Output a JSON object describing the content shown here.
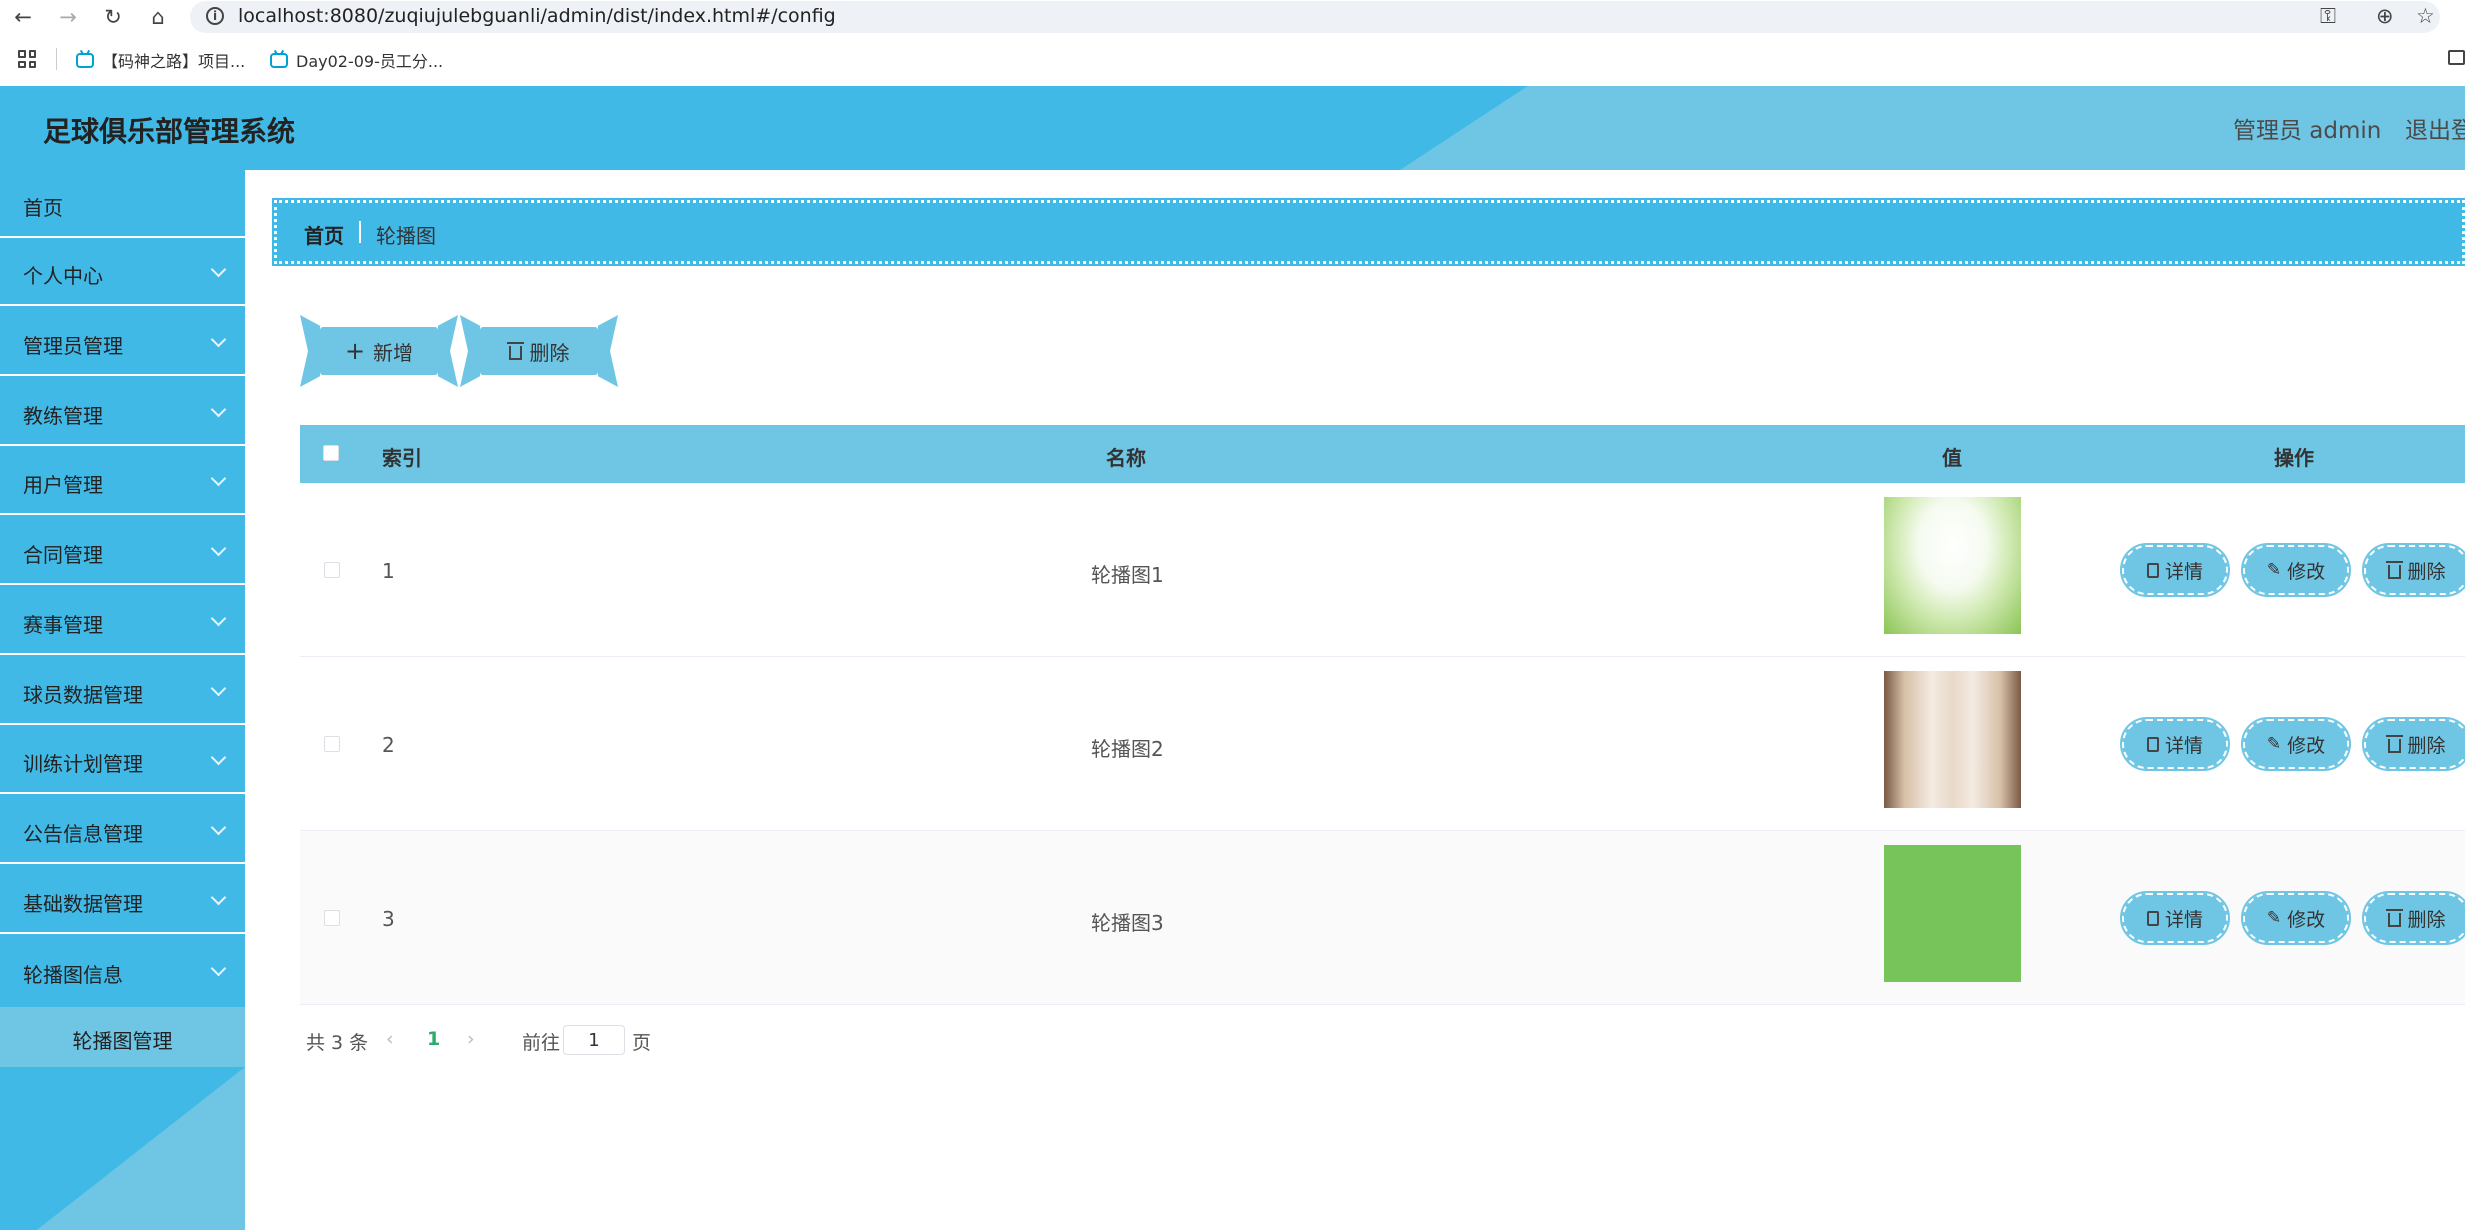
{
  "browser": {
    "url": "localhost:8080/zuqiujulebguanli/admin/dist/index.html#/config",
    "bookmarks": [
      {
        "label": "【码神之路】项目..."
      },
      {
        "label": "Day02-09-员工分..."
      }
    ]
  },
  "header": {
    "title": "足球俱乐部管理系统",
    "user": "管理员 admin",
    "logout": "退出登录"
  },
  "sidebar": {
    "items": [
      {
        "label": "首页",
        "expandable": false
      },
      {
        "label": "个人中心",
        "expandable": true
      },
      {
        "label": "管理员管理",
        "expandable": true
      },
      {
        "label": "教练管理",
        "expandable": true
      },
      {
        "label": "用户管理",
        "expandable": true
      },
      {
        "label": "合同管理",
        "expandable": true
      },
      {
        "label": "赛事管理",
        "expandable": true
      },
      {
        "label": "球员数据管理",
        "expandable": true
      },
      {
        "label": "训练计划管理",
        "expandable": true
      },
      {
        "label": "公告信息管理",
        "expandable": true
      },
      {
        "label": "基础数据管理",
        "expandable": true
      },
      {
        "label": "轮播图信息",
        "expandable": true
      }
    ],
    "active_sub": "轮播图管理"
  },
  "breadcrumb": {
    "home": "首页",
    "current": "轮播图"
  },
  "toolbar": {
    "add_label": "新增",
    "delete_label": "删除"
  },
  "table": {
    "columns": {
      "index": "索引",
      "name": "名称",
      "value": "值",
      "ops": "操作"
    },
    "rows": [
      {
        "index": "1",
        "name": "轮播图1"
      },
      {
        "index": "2",
        "name": "轮播图2"
      },
      {
        "index": "3",
        "name": "轮播图3"
      }
    ],
    "ops": {
      "detail": "详情",
      "edit": "修改",
      "delete": "删除"
    }
  },
  "pagination": {
    "total": "共 3 条",
    "current_page": "1",
    "goto_prefix": "前往",
    "goto_value": "1",
    "goto_suffix": "页"
  },
  "colors": {
    "primary": "#41b9e7",
    "light": "#6ec6e4",
    "page_active": "#2cab6b"
  }
}
